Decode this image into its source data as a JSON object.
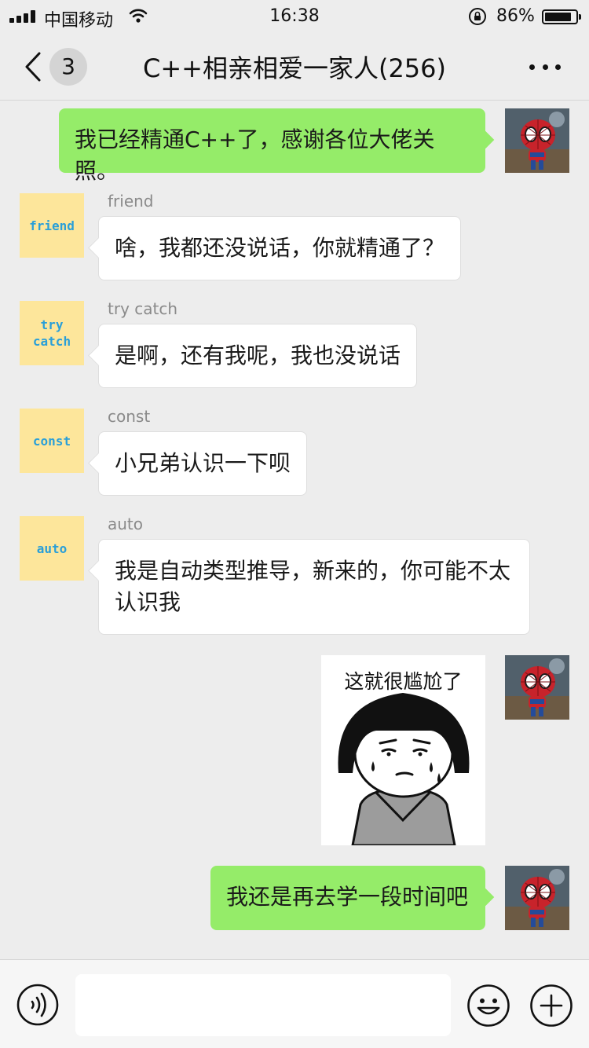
{
  "status_bar": {
    "carrier": "中国移动",
    "time": "16:38",
    "battery_percent": "86%",
    "battery_level": 0.86
  },
  "nav": {
    "unread_count": "3",
    "title": "C++相亲相爱一家人(256)"
  },
  "messages": [
    {
      "side": "out",
      "text": "我已经精通C++了，感谢各位大佬关照。"
    },
    {
      "side": "in",
      "sender": "friend",
      "avatar_text": "friend",
      "text": "啥，我都还没说话，你就精通了？"
    },
    {
      "side": "in",
      "sender": "try catch",
      "avatar_text": "try catch",
      "text": "是啊，还有我呢，我也没说话"
    },
    {
      "side": "in",
      "sender": "const",
      "avatar_text": "const",
      "text": "小兄弟认识一下呗"
    },
    {
      "side": "in",
      "sender": "auto",
      "avatar_text": "auto",
      "text": "我是自动类型推导，新来的，你可能不太认识我"
    },
    {
      "side": "out",
      "type": "sticker",
      "caption": "这就很尴尬了"
    },
    {
      "side": "out",
      "text": "我还是再去学一段时间吧"
    }
  ],
  "input_bar": {
    "value": "",
    "icons": [
      "voice-icon",
      "emoji-icon",
      "plus-icon"
    ]
  },
  "colors": {
    "outgoing_bubble": "#95ec69",
    "incoming_bubble": "#ffffff",
    "background": "#ededed",
    "keyword_avatar_bg": "#fde69b",
    "keyword_text": "#2a9fd8"
  }
}
